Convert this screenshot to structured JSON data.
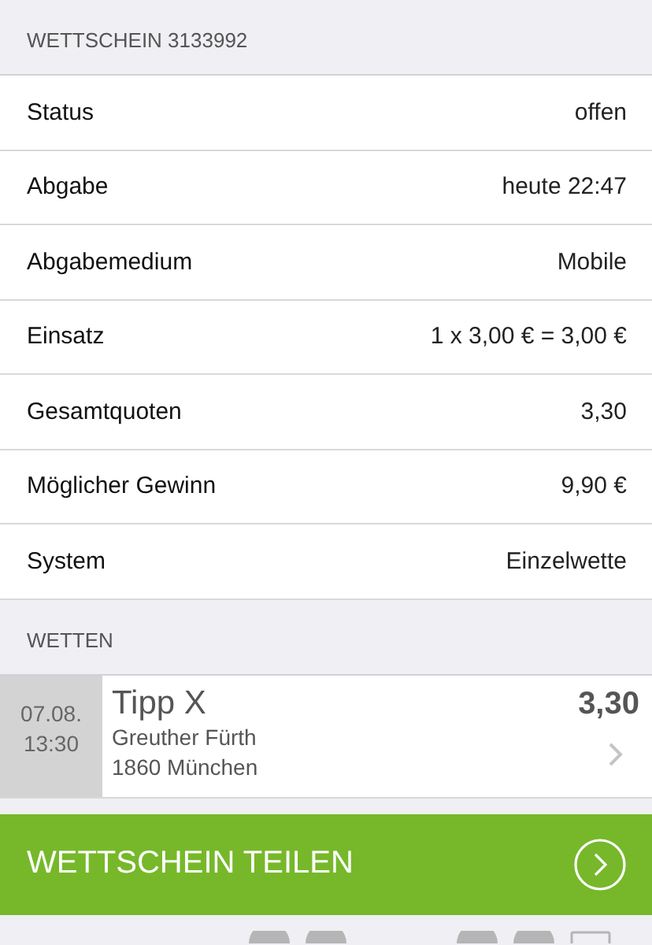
{
  "header": {
    "title": "WETTSCHEIN 3133992"
  },
  "details": [
    {
      "label": "Status",
      "value": "offen"
    },
    {
      "label": "Abgabe",
      "value": "heute 22:47"
    },
    {
      "label": "Abgabemedium",
      "value": "Mobile"
    },
    {
      "label": "Einsatz",
      "value": "1 x 3,00 € = 3,00 €"
    },
    {
      "label": "Gesamtquoten",
      "value": "3,30"
    },
    {
      "label": "Möglicher Gewinn",
      "value": "9,90 €"
    },
    {
      "label": "System",
      "value": "Einzelwette"
    }
  ],
  "bets_section": {
    "title": "WETTEN"
  },
  "bets": [
    {
      "date": "07.08.",
      "time": "13:30",
      "tip": "Tipp X",
      "home": "Greuther Fürth",
      "away": "1860 München",
      "odds": "3,30"
    }
  ],
  "share_button": {
    "label": "WETTSCHEIN TEILEN"
  }
}
